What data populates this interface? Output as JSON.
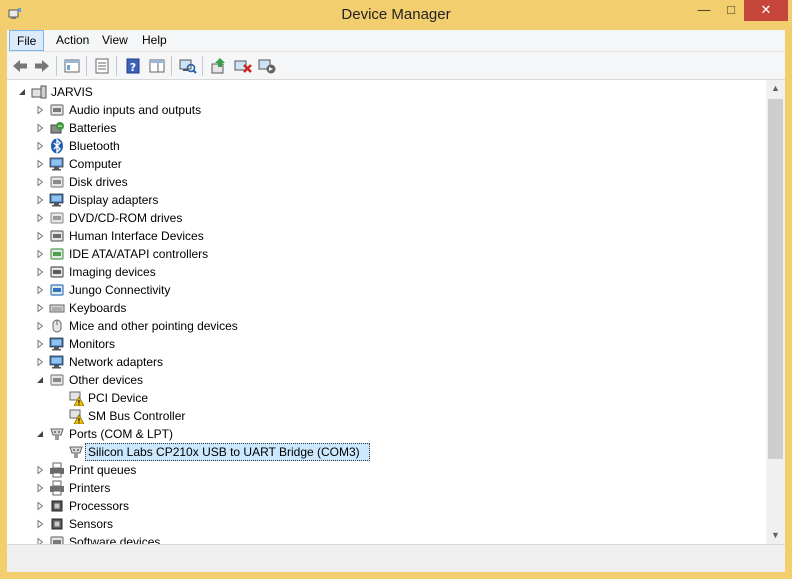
{
  "window": {
    "title": "Device Manager"
  },
  "menu": {
    "file": "File",
    "action": "Action",
    "view": "View",
    "help": "Help"
  },
  "tree": {
    "root": "JARVIS",
    "items": [
      {
        "label": "Audio inputs and outputs",
        "icon": "speaker-icon"
      },
      {
        "label": "Batteries",
        "icon": "battery-icon"
      },
      {
        "label": "Bluetooth",
        "icon": "bluetooth-icon"
      },
      {
        "label": "Computer",
        "icon": "computer-icon"
      },
      {
        "label": "Disk drives",
        "icon": "disk-drive-icon"
      },
      {
        "label": "Display adapters",
        "icon": "display-adapter-icon"
      },
      {
        "label": "DVD/CD-ROM drives",
        "icon": "dvd-drive-icon"
      },
      {
        "label": "Human Interface Devices",
        "icon": "hid-icon"
      },
      {
        "label": "IDE ATA/ATAPI controllers",
        "icon": "ide-controller-icon"
      },
      {
        "label": "Imaging devices",
        "icon": "camera-icon"
      },
      {
        "label": "Jungo Connectivity",
        "icon": "jungo-icon"
      },
      {
        "label": "Keyboards",
        "icon": "keyboard-icon"
      },
      {
        "label": "Mice and other pointing devices",
        "icon": "mouse-icon"
      },
      {
        "label": "Monitors",
        "icon": "monitor-icon"
      },
      {
        "label": "Network adapters",
        "icon": "network-adapter-icon"
      },
      {
        "label": "Other devices",
        "icon": "unknown-device-icon"
      },
      {
        "label": "PCI Device",
        "icon": "warning-device-icon"
      },
      {
        "label": "SM Bus Controller",
        "icon": "warning-device-icon"
      },
      {
        "label": "Ports (COM & LPT)",
        "icon": "port-icon"
      },
      {
        "label": "Silicon Labs CP210x USB to UART Bridge (COM3)",
        "icon": "port-icon"
      },
      {
        "label": "Print queues",
        "icon": "print-queue-icon"
      },
      {
        "label": "Printers",
        "icon": "printer-icon"
      },
      {
        "label": "Processors",
        "icon": "processor-icon"
      },
      {
        "label": "Sensors",
        "icon": "sensor-icon"
      },
      {
        "label": "Software devices",
        "icon": "software-device-icon"
      }
    ]
  },
  "colors": {
    "titlebar": "#f3ce6f",
    "close": "#c7463c",
    "selection": "#cce8ff"
  }
}
